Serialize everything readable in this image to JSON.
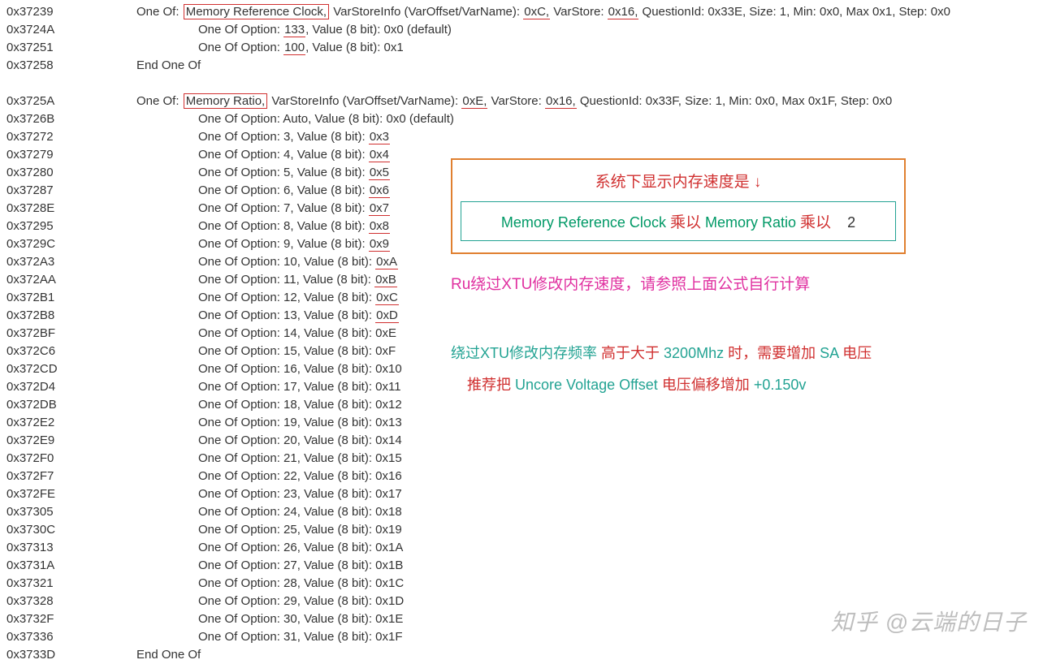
{
  "block1": {
    "header": {
      "addr": "0x37239",
      "prefix": "One Of:",
      "name": "Memory Reference Clock,",
      "mid1": " VarStoreInfo (VarOffset/VarName): ",
      "voff": "0xC,",
      "mid2": " VarStore: ",
      "vstore": "0x16,",
      "tail": " QuestionId: 0x33E, Size: 1, Min: 0x0, Max 0x1, Step: 0x0"
    },
    "rows": [
      {
        "addr": "0x3724A",
        "pre": "One Of Option: ",
        "name": "133",
        "post": ", Value (8 bit): 0x0 (default)",
        "u": true
      },
      {
        "addr": "0x37251",
        "pre": "One Of Option: ",
        "name": "100",
        "post": ", Value (8 bit): 0x1",
        "u": true
      }
    ],
    "end": {
      "addr": "0x37258",
      "text": "End One Of"
    }
  },
  "block2": {
    "header": {
      "addr": "0x3725A",
      "prefix": "One Of:",
      "name": "Memory Ratio,",
      "mid1": " VarStoreInfo (VarOffset/VarName): ",
      "voff": "0xE,",
      "mid2": " VarStore: ",
      "vstore": "0x16,",
      "tail": " QuestionId: 0x33F, Size: 1, Min: 0x0, Max 0x1F, Step: 0x0"
    },
    "rows": [
      {
        "addr": "0x3726B",
        "pre": "One Of Option: Auto, Value (8 bit): 0x0 (default)",
        "name": "",
        "post": "",
        "u": false
      },
      {
        "addr": "0x37272",
        "pre": "One Of Option: 3, Value (8 bit): ",
        "name": "0x3",
        "post": "",
        "u": true
      },
      {
        "addr": "0x37279",
        "pre": "One Of Option: 4, Value (8 bit): ",
        "name": "0x4",
        "post": "",
        "u": true
      },
      {
        "addr": "0x37280",
        "pre": "One Of Option: 5, Value (8 bit): ",
        "name": "0x5",
        "post": "",
        "u": true
      },
      {
        "addr": "0x37287",
        "pre": "One Of Option: 6, Value (8 bit): ",
        "name": "0x6",
        "post": "",
        "u": true
      },
      {
        "addr": "0x3728E",
        "pre": "One Of Option: 7, Value (8 bit): ",
        "name": "0x7",
        "post": "",
        "u": true
      },
      {
        "addr": "0x37295",
        "pre": "One Of Option: 8, Value (8 bit): ",
        "name": "0x8",
        "post": "",
        "u": true
      },
      {
        "addr": "0x3729C",
        "pre": "One Of Option: 9, Value (8 bit): ",
        "name": "0x9",
        "post": "",
        "u": true
      },
      {
        "addr": "0x372A3",
        "pre": "One Of Option: 10, Value (8 bit): ",
        "name": "0xA",
        "post": "",
        "u": true
      },
      {
        "addr": "0x372AA",
        "pre": "One Of Option: 11, Value (8 bit): ",
        "name": "0xB",
        "post": "",
        "u": true
      },
      {
        "addr": "0x372B1",
        "pre": "One Of Option: 12, Value (8 bit): ",
        "name": "0xC",
        "post": "",
        "u": true
      },
      {
        "addr": "0x372B8",
        "pre": "One Of Option: 13, Value (8 bit): ",
        "name": "0xD",
        "post": "",
        "u": true
      },
      {
        "addr": "0x372BF",
        "pre": "One Of Option: 14, Value (8 bit): 0xE",
        "name": "",
        "post": "",
        "u": false
      },
      {
        "addr": "0x372C6",
        "pre": "One Of Option: 15, Value (8 bit): 0xF",
        "name": "",
        "post": "",
        "u": false
      },
      {
        "addr": "0x372CD",
        "pre": "One Of Option: 16, Value (8 bit): 0x10",
        "name": "",
        "post": "",
        "u": false
      },
      {
        "addr": "0x372D4",
        "pre": "One Of Option: 17, Value (8 bit): 0x11",
        "name": "",
        "post": "",
        "u": false
      },
      {
        "addr": "0x372DB",
        "pre": "One Of Option: 18, Value (8 bit): 0x12",
        "name": "",
        "post": "",
        "u": false
      },
      {
        "addr": "0x372E2",
        "pre": "One Of Option: 19, Value (8 bit): 0x13",
        "name": "",
        "post": "",
        "u": false
      },
      {
        "addr": "0x372E9",
        "pre": "One Of Option: 20, Value (8 bit): 0x14",
        "name": "",
        "post": "",
        "u": false
      },
      {
        "addr": "0x372F0",
        "pre": "One Of Option: 21, Value (8 bit): 0x15",
        "name": "",
        "post": "",
        "u": false
      },
      {
        "addr": "0x372F7",
        "pre": "One Of Option: 22, Value (8 bit): 0x16",
        "name": "",
        "post": "",
        "u": false
      },
      {
        "addr": "0x372FE",
        "pre": "One Of Option: 23, Value (8 bit): 0x17",
        "name": "",
        "post": "",
        "u": false
      },
      {
        "addr": "0x37305",
        "pre": "One Of Option: 24, Value (8 bit): 0x18",
        "name": "",
        "post": "",
        "u": false
      },
      {
        "addr": "0x3730C",
        "pre": "One Of Option: 25, Value (8 bit): 0x19",
        "name": "",
        "post": "",
        "u": false
      },
      {
        "addr": "0x37313",
        "pre": "One Of Option: 26, Value (8 bit): 0x1A",
        "name": "",
        "post": "",
        "u": false
      },
      {
        "addr": "0x3731A",
        "pre": "One Of Option: 27, Value (8 bit): 0x1B",
        "name": "",
        "post": "",
        "u": false
      },
      {
        "addr": "0x37321",
        "pre": "One Of Option: 28, Value (8 bit): 0x1C",
        "name": "",
        "post": "",
        "u": false
      },
      {
        "addr": "0x37328",
        "pre": "One Of Option: 29, Value (8 bit): 0x1D",
        "name": "",
        "post": "",
        "u": false
      },
      {
        "addr": "0x3732F",
        "pre": "One Of Option: 30, Value (8 bit): 0x1E",
        "name": "",
        "post": "",
        "u": false
      },
      {
        "addr": "0x37336",
        "pre": "One Of Option: 31, Value (8 bit): 0x1F",
        "name": "",
        "post": "",
        "u": false
      }
    ],
    "end": {
      "addr": "0x3733D",
      "text": "End One Of"
    }
  },
  "panel": {
    "formula_title": "系统下显示内存速度是 ↓",
    "f_a": "Memory Reference Clock",
    "f_op1": "乘以",
    "f_b": "Memory Ratio",
    "f_op2": "乘以",
    "f_c": "2",
    "magenta": "Ru绕过XTU修改内存速度，请参照上面公式自行计算",
    "m2": {
      "a": "绕过XTU修改内存频率 ",
      "b": "高于大于 ",
      "c": "3200Mhz ",
      "d": "时，需要增加 ",
      "e": "SA ",
      "f": "电压",
      "g": "推荐把 ",
      "h": "Uncore Voltage Offset ",
      "i": "电压偏移增加 ",
      "j": "+0.150v"
    }
  },
  "watermark": "知乎 @云端的日子"
}
